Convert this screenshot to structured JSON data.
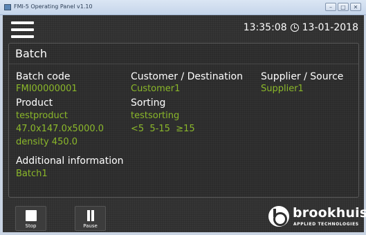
{
  "window": {
    "title": "FMI-5 Operating Panel v1.10"
  },
  "header": {
    "time": "13:35:08",
    "date": "13-01-2018"
  },
  "batch": {
    "title": "Batch",
    "batch_code": {
      "label": "Batch code",
      "value": "FMI00000001"
    },
    "customer": {
      "label": "Customer / Destination",
      "value": "Customer1"
    },
    "supplier": {
      "label": "Supplier / Source",
      "value": "Supplier1"
    },
    "product": {
      "label": "Product",
      "name": "testproduct",
      "dimensions": "47.0x147.0x5000.0",
      "density": "density 450.0"
    },
    "sorting": {
      "label": "Sorting",
      "name": "testsorting",
      "classes": "<5  5-15  ≥15"
    },
    "additional": {
      "label": "Additional information",
      "value": "Batch1"
    }
  },
  "controls": {
    "stop_label": "Stop",
    "pause_label": "Pause"
  },
  "brand": {
    "name": "brookhuis",
    "tagline": "APPLIED TECHNOLOGIES"
  },
  "colors": {
    "accent_green": "#8bb82a",
    "background": "#2f2f2f",
    "text": "#ffffff"
  }
}
